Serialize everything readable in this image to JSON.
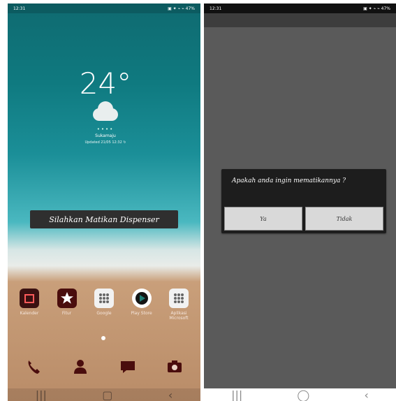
{
  "left_phone": {
    "status_bar": {
      "time": "12:31",
      "right": "▣ ✦ ⌁ ⌁ 47%"
    },
    "weather": {
      "temperature": "24°",
      "condition_icon": "cloud-icon",
      "location": "Sukamaju",
      "updated": "Updated 21/05 12:32 ↻"
    },
    "toast": "Silahkan Matikan Dispenser",
    "apps": [
      {
        "label": "Kalender",
        "icon": "calendar-icon",
        "bg": "#3a1111",
        "fg": "#ff5b5b"
      },
      {
        "label": "Fitur",
        "icon": "star-icon",
        "bg": "#4a0d0d",
        "fg": "#ffffff"
      },
      {
        "label": "Google",
        "icon": "grid-icon",
        "bg": "#f2f2f2",
        "fg": "#666666"
      },
      {
        "label": "Play Store",
        "icon": "play-icon",
        "bg": "#ffffff",
        "fg": "#1f7d74"
      },
      {
        "label": "Aplikasi Microsoft",
        "icon": "grid-icon",
        "bg": "#f2f2f2",
        "fg": "#666666"
      }
    ],
    "dock": [
      {
        "icon": "phone-icon"
      },
      {
        "icon": "contacts-icon"
      },
      {
        "icon": "message-icon"
      },
      {
        "icon": "camera-icon"
      }
    ],
    "nav": [
      "|||",
      "▢",
      "‹"
    ]
  },
  "right_phone": {
    "status_bar": {
      "time": "12:31",
      "right": "▣ ✦ ⌁ ⌁ 47%"
    },
    "dialog": {
      "text": "Apakah anda ingin mematikannya ?",
      "yes_label": "Ya",
      "no_label": "Tidak"
    },
    "nav": [
      "|||",
      "◯",
      "‹"
    ]
  }
}
